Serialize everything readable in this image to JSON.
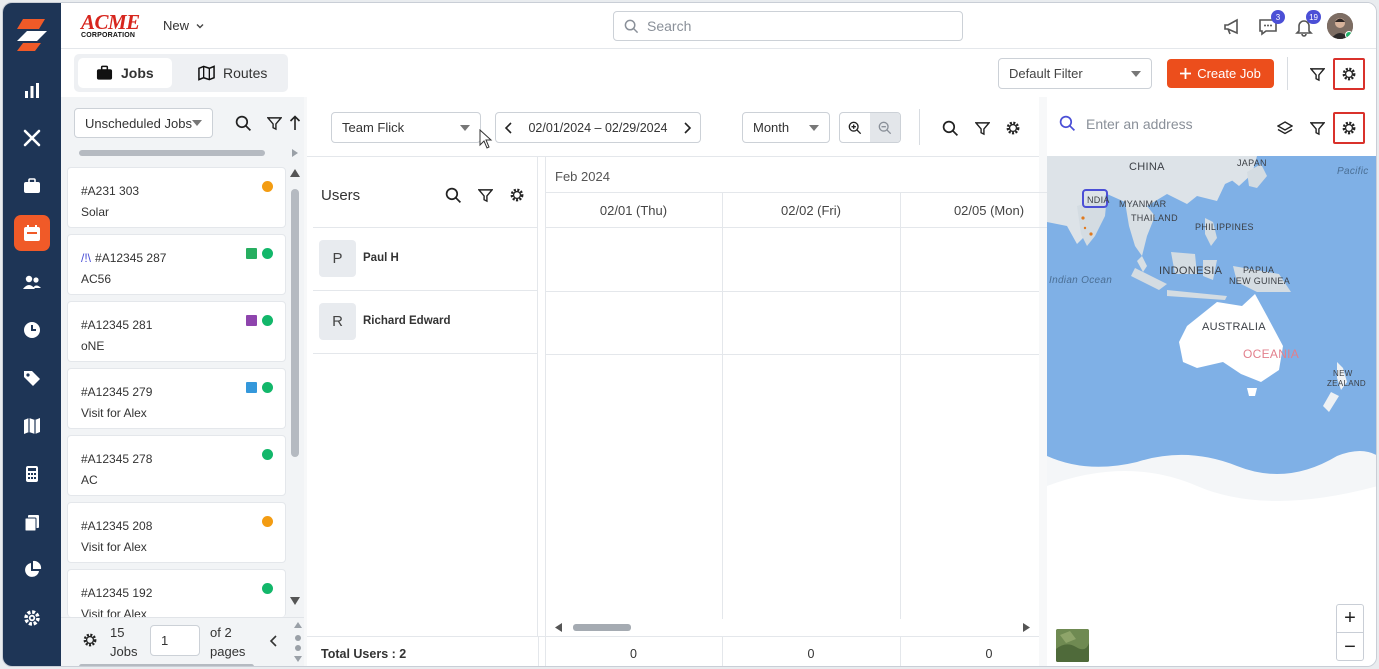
{
  "header": {
    "brand_name": "ACME",
    "brand_sub": "CORPORATION",
    "new_label": "New",
    "search_placeholder": "Search",
    "chat_badge": "3",
    "notification_badge": "19"
  },
  "toolbar": {
    "tabs": [
      {
        "label": "Jobs",
        "icon": "briefcase-icon",
        "active": true
      },
      {
        "label": "Routes",
        "icon": "map-icon",
        "active": false
      }
    ],
    "filter_value": "Default Filter",
    "create_label": "Create Job",
    "accent": "#ec4e1c"
  },
  "jobs_panel": {
    "type_value": "Unscheduled Jobs",
    "jobs": [
      {
        "number": "#A231 303",
        "title": "Solar",
        "marks": [
          {
            "shape": "circle",
            "color": "#f39c12"
          }
        ]
      },
      {
        "prefix": "/!\\",
        "number": "#A12345 287",
        "title": "AC56",
        "marks": [
          {
            "shape": "square",
            "color": "#27ae60"
          },
          {
            "shape": "circle",
            "color": "#12b76a"
          }
        ]
      },
      {
        "number": "#A12345 281",
        "title": "oNE",
        "marks": [
          {
            "shape": "square",
            "color": "#8e44ad"
          },
          {
            "shape": "circle",
            "color": "#12b76a"
          }
        ]
      },
      {
        "number": "#A12345 279",
        "title": "Visit for Alex",
        "marks": [
          {
            "shape": "square",
            "color": "#3498db"
          },
          {
            "shape": "circle",
            "color": "#12b76a"
          }
        ]
      },
      {
        "number": "#A12345 278",
        "title": "AC",
        "marks": [
          {
            "shape": "circle",
            "color": "#12b76a"
          }
        ]
      },
      {
        "number": "#A12345 208",
        "title": "Visit for Alex",
        "marks": [
          {
            "shape": "circle",
            "color": "#f39c12"
          }
        ]
      },
      {
        "number": "#A12345 192",
        "title": "Visit for Alex",
        "marks": [
          {
            "shape": "circle",
            "color": "#12b76a"
          }
        ]
      }
    ],
    "footer": {
      "count": "15",
      "count_label": "Jobs",
      "page_value": "1",
      "of_label": "of 2",
      "pages_label": "pages"
    }
  },
  "scheduler": {
    "team_value": "Team Flick",
    "date_range": "02/01/2024 – 02/29/2024",
    "view_value": "Month",
    "users_title": "Users",
    "users": [
      {
        "initial": "P",
        "name": "Paul H"
      },
      {
        "initial": "R",
        "name": "Richard Edward"
      }
    ],
    "month_label": "Feb 2024",
    "days": [
      "02/01 (Thu)",
      "02/02 (Fri)",
      "02/05 (Mon)"
    ],
    "total_users": "Total Users : 2",
    "totals": [
      "0",
      "0",
      "0"
    ]
  },
  "map": {
    "address_placeholder": "Enter an address",
    "labels": {
      "china": "CHINA",
      "japan": "JAPAN",
      "pacific": "Pacific",
      "india": "NDIA",
      "myanmar": "MYANMAR",
      "thailand": "THAILAND",
      "philippines": "PHILIPPINES",
      "indonesia": "INDONESIA",
      "papua": "PAPUA",
      "new_guinea": "NEW GUINEA",
      "indian_ocean": "Indian Ocean",
      "australia": "AUSTRALIA",
      "oceania": "OCEANIA",
      "new": "NEW",
      "zealand": "ZEALAND"
    },
    "zoom_in": "+",
    "zoom_out": "−"
  }
}
